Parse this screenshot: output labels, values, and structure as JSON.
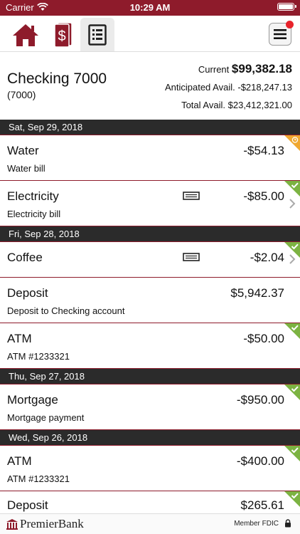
{
  "status_bar": {
    "carrier": "Carrier",
    "time": "10:29 AM"
  },
  "nav": {
    "icons": [
      "home-icon",
      "accounts-dollar-icon",
      "transactions-list-icon",
      "menu-icon"
    ],
    "accent": "#8e1b2b"
  },
  "account": {
    "name": "Checking 7000",
    "number": "(7000)",
    "current_label": "Current",
    "current_value": "$99,382.18",
    "anticipated_label": "Anticipated Avail.",
    "anticipated_value": "-$218,247.13",
    "total_label": "Total Avail.",
    "total_value": "$23,412,321.00"
  },
  "dates": [
    "Sat, Sep 29, 2018",
    "Fri, Sep 28, 2018",
    "Thu, Sep 27, 2018",
    "Wed, Sep 26, 2018"
  ],
  "transactions": [
    {
      "name": "Water",
      "amount": "-$54.13",
      "description": "Water bill",
      "status": "pending"
    },
    {
      "name": "Electricity",
      "amount": "-$85.00",
      "description": "Electricity bill",
      "status": "cleared"
    },
    {
      "name": "Coffee",
      "amount": "-$2.04",
      "description": "",
      "status": "cleared"
    },
    {
      "name": "Deposit",
      "amount": "$5,942.37",
      "description": "Deposit to Checking account",
      "status": "cleared"
    },
    {
      "name": "ATM",
      "amount": "-$50.00",
      "description": "ATM #1233321",
      "status": "cleared"
    },
    {
      "name": "Mortgage",
      "amount": "-$950.00",
      "description": "Mortgage payment",
      "status": "cleared"
    },
    {
      "name": "ATM",
      "amount": "-$400.00",
      "description": "ATM #1233321",
      "status": "cleared"
    },
    {
      "name": "Deposit",
      "amount": "$265.61",
      "description": "",
      "status": "cleared"
    }
  ],
  "status_colors": {
    "pending": "#f0a830",
    "cleared": "#7cb342"
  },
  "footer": {
    "brand": "PremierBank",
    "fdic": "Member FDIC"
  }
}
